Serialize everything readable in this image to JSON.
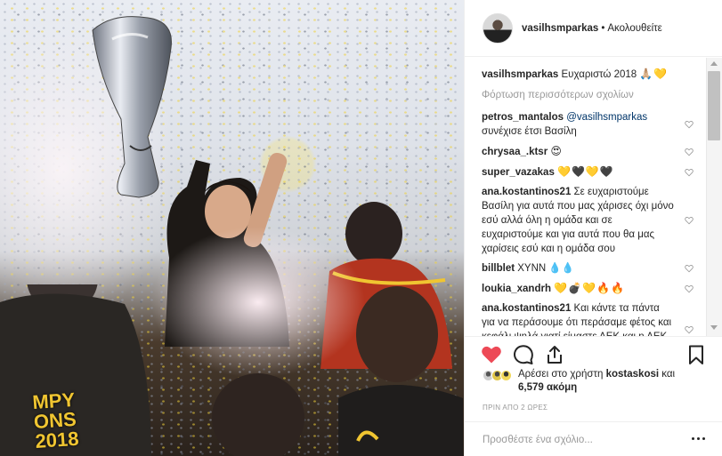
{
  "post": {
    "username": "vasilhsmparkas",
    "separator": "•",
    "follow_status": "Ακολουθείτε"
  },
  "caption": {
    "username": "vasilhsmparkas",
    "text": "Ευχαριστώ 2018",
    "emoji": "🙏🏼💛"
  },
  "load_more": "Φόρτωση περισσότερων σχολίων",
  "comments": [
    {
      "user": "petros_mantalos",
      "mention": "@vasilhsmparkas",
      "text": "συνέχισε έτσι Βασίλη"
    },
    {
      "user": "chrysaa_.ktsr",
      "mention": "",
      "text": "😍"
    },
    {
      "user": "super_vazakas",
      "mention": "",
      "text": "💛🖤💛🖤"
    },
    {
      "user": "ana.kostantinos21",
      "mention": "",
      "text": "Σε ευχαριστούμε Βασίλη για αυτά που μας χάρισες όχι μόνο εσύ αλλά όλη η ομάδα και σε ευχαριστούμε και για αυτά που θα μας χαρίσεις εσύ και η ομάδα σου"
    },
    {
      "user": "billblet",
      "mention": "",
      "text": "XYNN 💧💧"
    },
    {
      "user": "loukia_xandrh",
      "mention": "",
      "text": "💛💣💛🔥🔥"
    },
    {
      "user": "ana.kostantinos21",
      "mention": "",
      "text": "Και κάντε τα πάντα για να περάσουμε ότι περάσαμε φέτος και κεφάλι ψηλά γιατί είμαστε ΑΕΚ και η ΑΕΚ δεν σταματάει ποτέ"
    }
  ],
  "likes": {
    "prefix": "Αρέσει στο χρήστη",
    "user": "kostaskosi",
    "middle": "και",
    "count": "6,579 ακόμη"
  },
  "timestamp": "ΠΡΙΝ ΑΠΟ 2 ΩΡΕΣ",
  "add_comment": {
    "placeholder": "Προσθέστε ένα σχόλιο..."
  },
  "photo": {
    "shirt_text": "MPY\nONS\n2018"
  },
  "colors": {
    "like_red": "#ed4956",
    "mention_blue": "#003569",
    "muted": "#999999",
    "border": "#efefef"
  },
  "icons": [
    "heart-filled-icon",
    "comment-icon",
    "share-icon",
    "bookmark-icon",
    "more-options-icon",
    "heart-outline-icon"
  ]
}
